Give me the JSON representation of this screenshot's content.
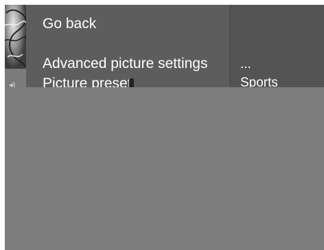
{
  "menu": {
    "items": [
      {
        "label": "Go back"
      },
      {
        "label": "Advanced picture settings"
      },
      {
        "label": "Picture preset"
      }
    ]
  },
  "values": {
    "items": [
      {
        "label": "..."
      },
      {
        "label": "Sports"
      }
    ]
  },
  "icons": {
    "speaker": "speaker-icon"
  },
  "colors": {
    "menu_background": "#5d5d5d",
    "value_background": "#545454",
    "overlay": "#7d7d7d",
    "text": "#ffffff"
  }
}
